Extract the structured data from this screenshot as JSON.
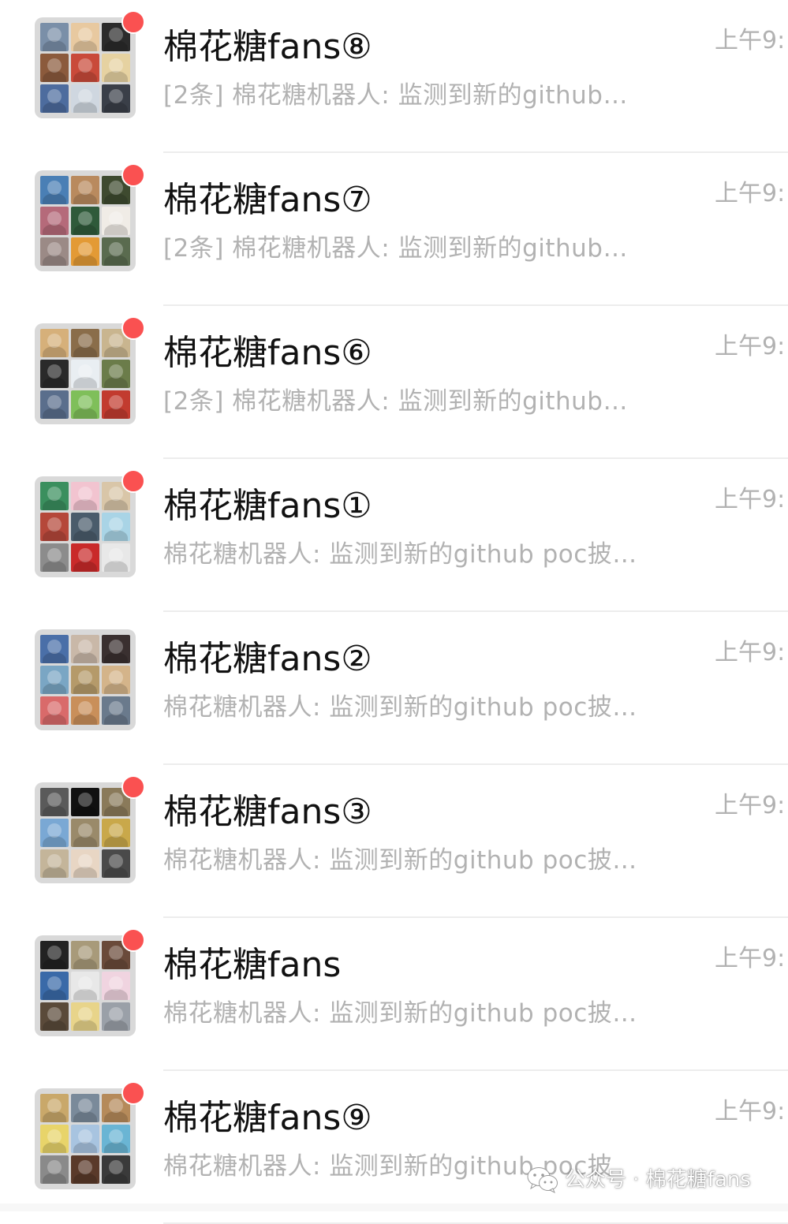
{
  "chats": [
    {
      "title": "棉花糖fans⑧",
      "preview": "[2条] 棉花糖机器人: 监测到新的github…",
      "time": "上午9:",
      "unread": true,
      "avatar_colors": [
        "#7a8fa8",
        "#e8c9a0",
        "#2b2b2b",
        "#8b5a3c",
        "#c94a3a",
        "#e6d2a1",
        "#4d6c9e",
        "#cfd7e0",
        "#3a3f48"
      ]
    },
    {
      "title": "棉花糖fans⑦",
      "preview": "[2条] 棉花糖机器人: 监测到新的github…",
      "time": "上午9:",
      "unread": true,
      "avatar_colors": [
        "#4a7fb5",
        "#b98a5e",
        "#3e4a2f",
        "#b56a7a",
        "#2f5a3a",
        "#f0ece6",
        "#9b8a86",
        "#e39a35",
        "#5a6b4f"
      ]
    },
    {
      "title": "棉花糖fans⑥",
      "preview": "[2条] 棉花糖机器人: 监测到新的github…",
      "time": "上午9:",
      "unread": true,
      "avatar_colors": [
        "#d6b07a",
        "#8a6d4a",
        "#c9b58f",
        "#2a2a2a",
        "#e9eef2",
        "#6b7c4a",
        "#5a6e8c",
        "#7fbf5a",
        "#c23b2f"
      ]
    },
    {
      "title": "棉花糖fans①",
      "preview": "棉花糖机器人: 监测到新的github poc披…",
      "time": "上午9:",
      "unread": true,
      "avatar_colors": [
        "#3a8f5e",
        "#f2c4d0",
        "#d9c6a8",
        "#b5473a",
        "#4a5c6b",
        "#a9d4e6",
        "#8c8c8c",
        "#c92a2a",
        "#e8e8e8"
      ]
    },
    {
      "title": "棉花糖fans②",
      "preview": "棉花糖机器人: 监测到新的github poc披…",
      "time": "上午9:",
      "unread": false,
      "avatar_colors": [
        "#4a6fa8",
        "#c9b8a8",
        "#3a3030",
        "#7aa6c4",
        "#b59a6a",
        "#d4b48a",
        "#d96a6a",
        "#c98f5a",
        "#6a7a8c"
      ]
    },
    {
      "title": "棉花糖fans③",
      "preview": "棉花糖机器人: 监测到新的github poc披…",
      "time": "上午9:",
      "unread": true,
      "avatar_colors": [
        "#5a5a5a",
        "#111111",
        "#8a7a5a",
        "#7aa8d4",
        "#9a8a6a",
        "#c9a84a",
        "#c4b59a",
        "#e8d6c4",
        "#4a4a4a"
      ]
    },
    {
      "title": "棉花糖fans",
      "preview": "棉花糖机器人: 监测到新的github poc披…",
      "time": "上午9:",
      "unread": true,
      "avatar_colors": [
        "#222222",
        "#a89a7a",
        "#6a4a3a",
        "#3a6aa8",
        "#e8e8e8",
        "#f0d4e0",
        "#5a4a3a",
        "#e8d48a",
        "#9aa0a8"
      ]
    },
    {
      "title": "棉花糖fans⑨",
      "preview": "棉花糖机器人: 监测到新的github poc披",
      "time": "上午9:",
      "unread": true,
      "avatar_colors": [
        "#c9a86a",
        "#7a8a9a",
        "#b58a5a",
        "#e8d46a",
        "#a8c4e0",
        "#6ab5d4",
        "#8a8a8a",
        "#5a3a2a",
        "#3a3a3a"
      ]
    }
  ],
  "watermark": {
    "icon": "wechat-icon",
    "text": "公众号 · 棉花糖fans"
  },
  "colors": {
    "unread_dot": "#fa5151",
    "title": "#111111",
    "secondary": "#b2b2b2",
    "divider": "#ededed"
  }
}
